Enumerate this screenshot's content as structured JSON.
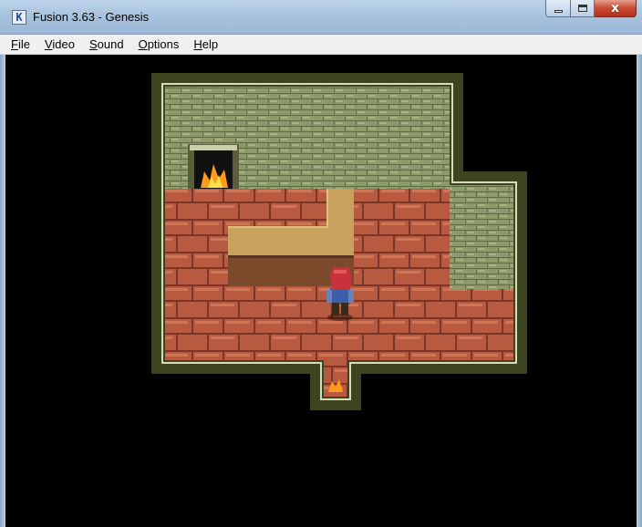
{
  "window": {
    "title": "Fusion 3.63 - Genesis",
    "icon": "fusion-app-icon",
    "icon_glyph": "K",
    "buttons": {
      "minimize": "minimize-icon",
      "maximize": "maximize-icon",
      "close": "close-icon",
      "close_glyph": "x"
    }
  },
  "menu": {
    "items": [
      {
        "accel": "F",
        "rest": "ile"
      },
      {
        "accel": "V",
        "rest": "ideo"
      },
      {
        "accel": "S",
        "rest": "ound"
      },
      {
        "accel": "O",
        "rest": "ptions"
      },
      {
        "accel": "H",
        "rest": "elp"
      }
    ]
  },
  "game": {
    "scene": "indoor-room-with-fireplace",
    "colors": {
      "background": "#000000",
      "wall_stone": "#8e9a6a",
      "wall_mortar": "#5f6b43",
      "floor_brick": "#b85a40",
      "floor_mortar": "#7a3428",
      "counter_top": "#c9a25e",
      "counter_front": "#7a4a2a",
      "border_dark": "#3d4420",
      "border_light": "#d8dcb8",
      "fire": "#ff9a1a"
    },
    "objects": [
      "fireplace",
      "wooden-counter",
      "player-character",
      "doorway-torch"
    ]
  }
}
